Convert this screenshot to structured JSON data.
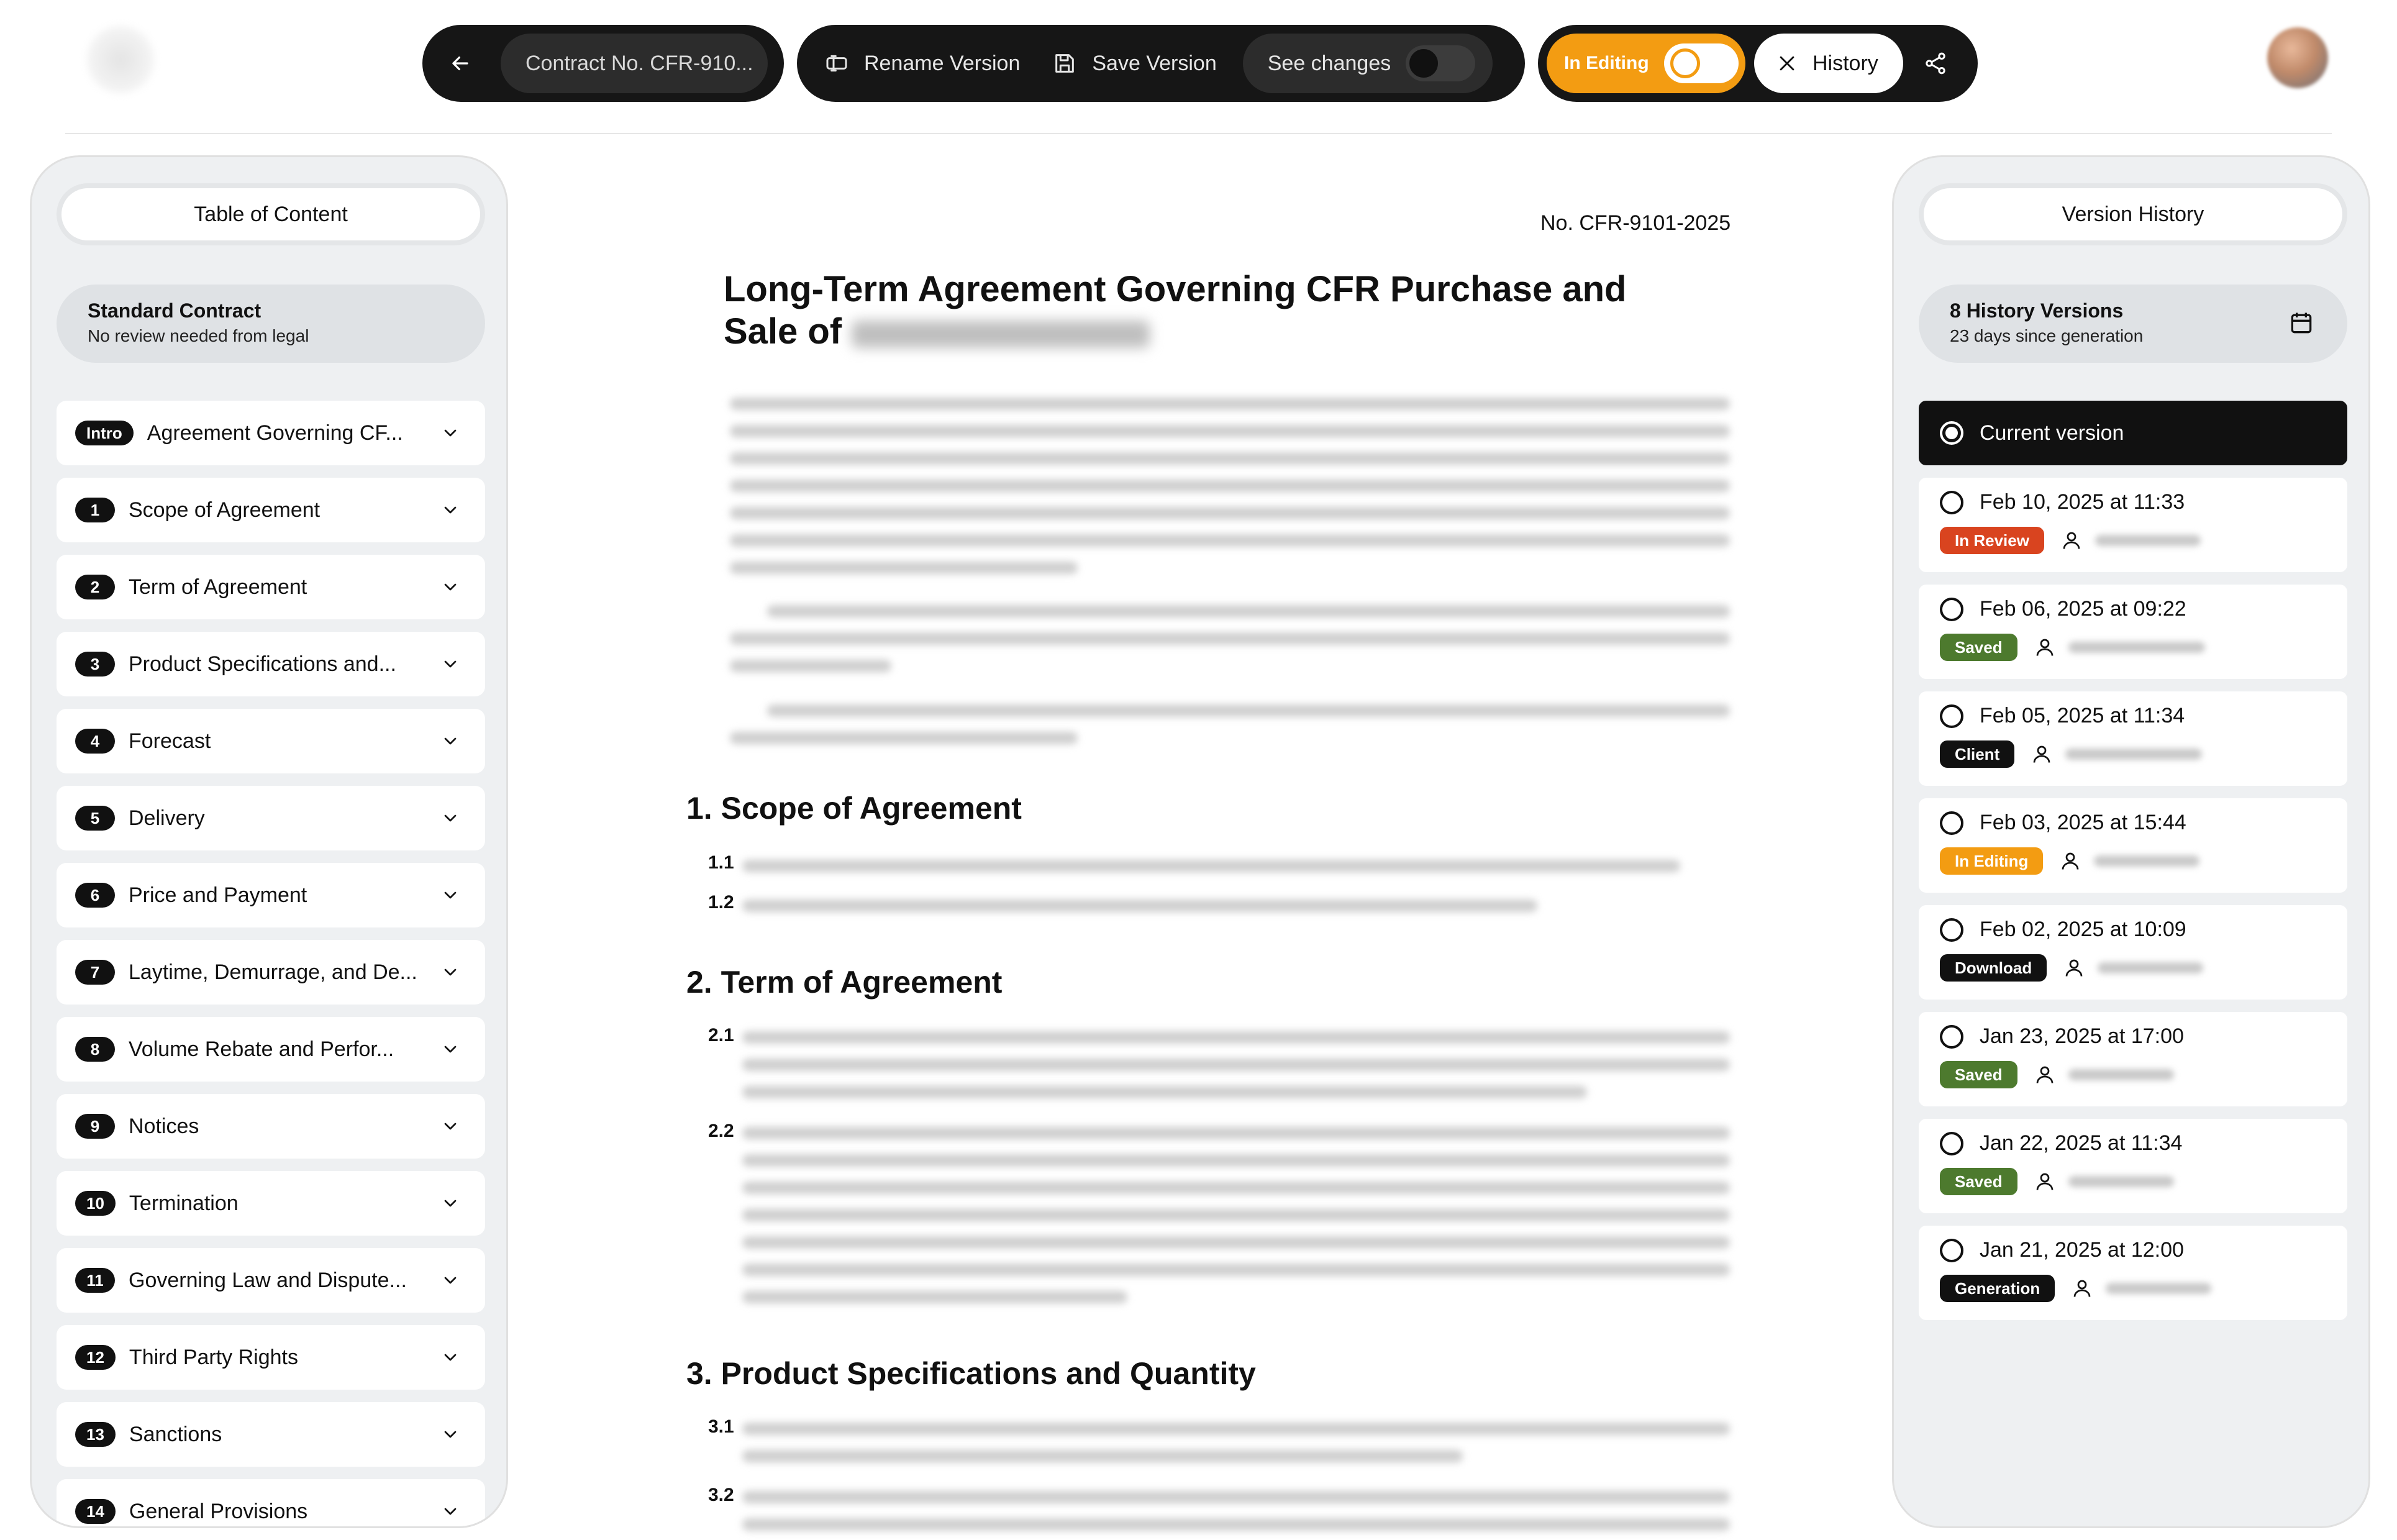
{
  "header": {
    "contract_label": "Contract No. CFR-910...",
    "rename_label": "Rename Version",
    "save_label": "Save Version",
    "see_changes_label": "See changes",
    "in_editing_label": "In Editing",
    "history_label": "History"
  },
  "toc": {
    "title": "Table of Content",
    "info_title": "Standard Contract",
    "info_subtitle": "No review needed from legal",
    "items": [
      {
        "badge": "Intro",
        "label": "Agreement Governing CF..."
      },
      {
        "badge": "1",
        "label": "Scope of Agreement"
      },
      {
        "badge": "2",
        "label": "Term of Agreement"
      },
      {
        "badge": "3",
        "label": "Product Specifications and..."
      },
      {
        "badge": "4",
        "label": "Forecast"
      },
      {
        "badge": "5",
        "label": "Delivery"
      },
      {
        "badge": "6",
        "label": "Price and Payment"
      },
      {
        "badge": "7",
        "label": "Laytime, Demurrage, and De..."
      },
      {
        "badge": "8",
        "label": "Volume Rebate and Perfor..."
      },
      {
        "badge": "9",
        "label": "Notices"
      },
      {
        "badge": "10",
        "label": "Termination"
      },
      {
        "badge": "11",
        "label": "Governing Law and Dispute..."
      },
      {
        "badge": "12",
        "label": "Third Party Rights"
      },
      {
        "badge": "13",
        "label": "Sanctions"
      },
      {
        "badge": "14",
        "label": "General Provisions"
      }
    ]
  },
  "document": {
    "number": "No. CFR-9101-2025",
    "title": "Long-Term Agreement Governing CFR Purchase and Sale of",
    "sections": [
      {
        "heading": "1. Scope of Agreement",
        "clauses": [
          "1.1",
          "1.2"
        ]
      },
      {
        "heading": "2. Term of Agreement",
        "clauses": [
          "2.1",
          "2.2"
        ]
      },
      {
        "heading": "3. Product Specifications and Quantity",
        "clauses": [
          "3.1",
          "3.2"
        ]
      }
    ]
  },
  "versions": {
    "title": "Version History",
    "info_title": "8 History Versions",
    "info_subtitle": "23 days since generation",
    "current_label": "Current version",
    "items": [
      {
        "date": "Feb 10, 2025 at 11:33",
        "tag": "In Review",
        "tag_color": "#d9441f"
      },
      {
        "date": "Feb 06, 2025 at 09:22",
        "tag": "Saved",
        "tag_color": "#4d7a2e"
      },
      {
        "date": "Feb 05, 2025 at 11:34",
        "tag": "Client",
        "tag_color": "#111111"
      },
      {
        "date": "Feb 03, 2025 at 15:44",
        "tag": "In Editing",
        "tag_color": "#f39c12"
      },
      {
        "date": "Feb 02, 2025 at 10:09",
        "tag": "Download",
        "tag_color": "#111111"
      },
      {
        "date": "Jan 23, 2025 at 17:00",
        "tag": "Saved",
        "tag_color": "#4d7a2e"
      },
      {
        "date": "Jan 22, 2025 at 11:34",
        "tag": "Saved",
        "tag_color": "#4d7a2e"
      },
      {
        "date": "Jan 21, 2025 at 12:00",
        "tag": "Generation",
        "tag_color": "#111111"
      }
    ]
  },
  "colors": {
    "accent": "#f39c12",
    "dark": "#161616",
    "panel": "#eef0f2"
  }
}
